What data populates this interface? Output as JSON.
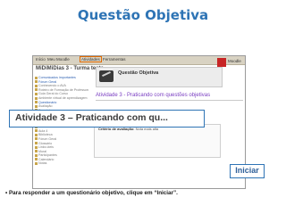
{
  "slide": {
    "title": "Questão Objetiva",
    "callout_text": "Atividade 3 – Praticando com qu...",
    "action_label": "Iniciar",
    "caption": "• Para responder a um questionário objetivo, clique em “Iniciar”."
  },
  "screenshot": {
    "menu": [
      "Início",
      "Meu Moodle",
      "Atividades",
      "Ferramentas"
    ],
    "course_title": "MiDiMiDias 3 - Turma teste",
    "logo_text": "Moodle",
    "banner_title": "Questão Objetiva",
    "activity_heading": "Atividade 3 - Praticando com questões objetivas",
    "eval_label": "Critério de avaliação:",
    "eval_value": "Nota mais alta",
    "sidebar": [
      "Comunicados importantes",
      "Fórum Geral",
      "Conhecendo o AVA",
      "Roteiro de Formação de Professores",
      "Guia Geral do Curso",
      "Ambiente virtual de aprendizagem",
      "Questionário",
      "Avaliação",
      "Exercício",
      "Cronograma",
      "Aula 1",
      "Aula 2",
      "Aula 3",
      "Aula 4",
      "Biblioteca",
      "Fórum Geral",
      "Glossário",
      "Links úteis",
      "Mural",
      "Participantes",
      "Calendário",
      "Notas"
    ]
  }
}
